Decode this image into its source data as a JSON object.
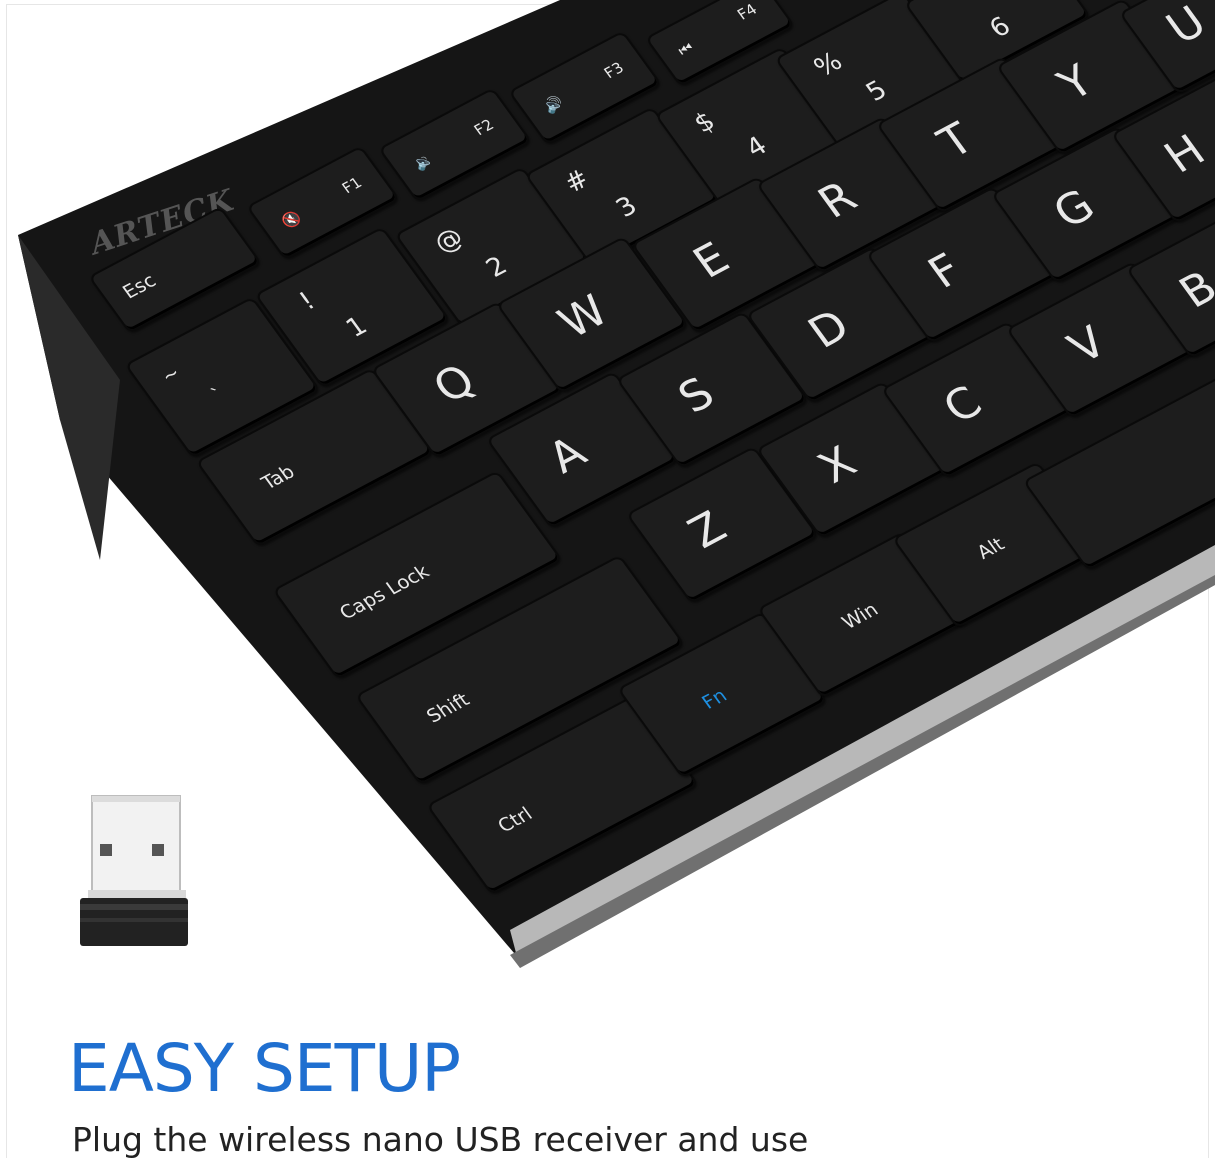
{
  "brand": "ARTECK",
  "keys": {
    "esc": "Esc",
    "f1": "F1",
    "f2": "F2",
    "f3": "F3",
    "f4": "F4",
    "tilde_top": "~",
    "tilde_bottom": "`",
    "n1_top": "!",
    "n1": "1",
    "n2_top": "@",
    "n2": "2",
    "n3_top": "#",
    "n3": "3",
    "n4_top": "$",
    "n4": "4",
    "n5_top": "%",
    "n5": "5",
    "n6": "6",
    "tab": "Tab",
    "q": "Q",
    "w": "W",
    "e": "E",
    "r": "R",
    "t": "T",
    "y": "Y",
    "u": "U",
    "caps": "Caps Lock",
    "a": "A",
    "s": "S",
    "d": "D",
    "f": "F",
    "g": "G",
    "h": "H",
    "shift": "Shift",
    "z": "Z",
    "x": "X",
    "c": "C",
    "v": "V",
    "b": "B",
    "ctrl": "Ctrl",
    "fn": "Fn",
    "win": "Win",
    "alt": "Alt"
  },
  "icons": {
    "f1": "mute-icon",
    "f2": "volume-down-icon",
    "f3": "volume-up-icon",
    "f4": "previous-track-icon"
  },
  "colors": {
    "heading": "#1f6fd0",
    "fn_key": "#1e8fe0",
    "keyboard": "#161616"
  },
  "heading": "EASY SETUP",
  "subtext": "Plug the wireless nano USB receiver and use"
}
